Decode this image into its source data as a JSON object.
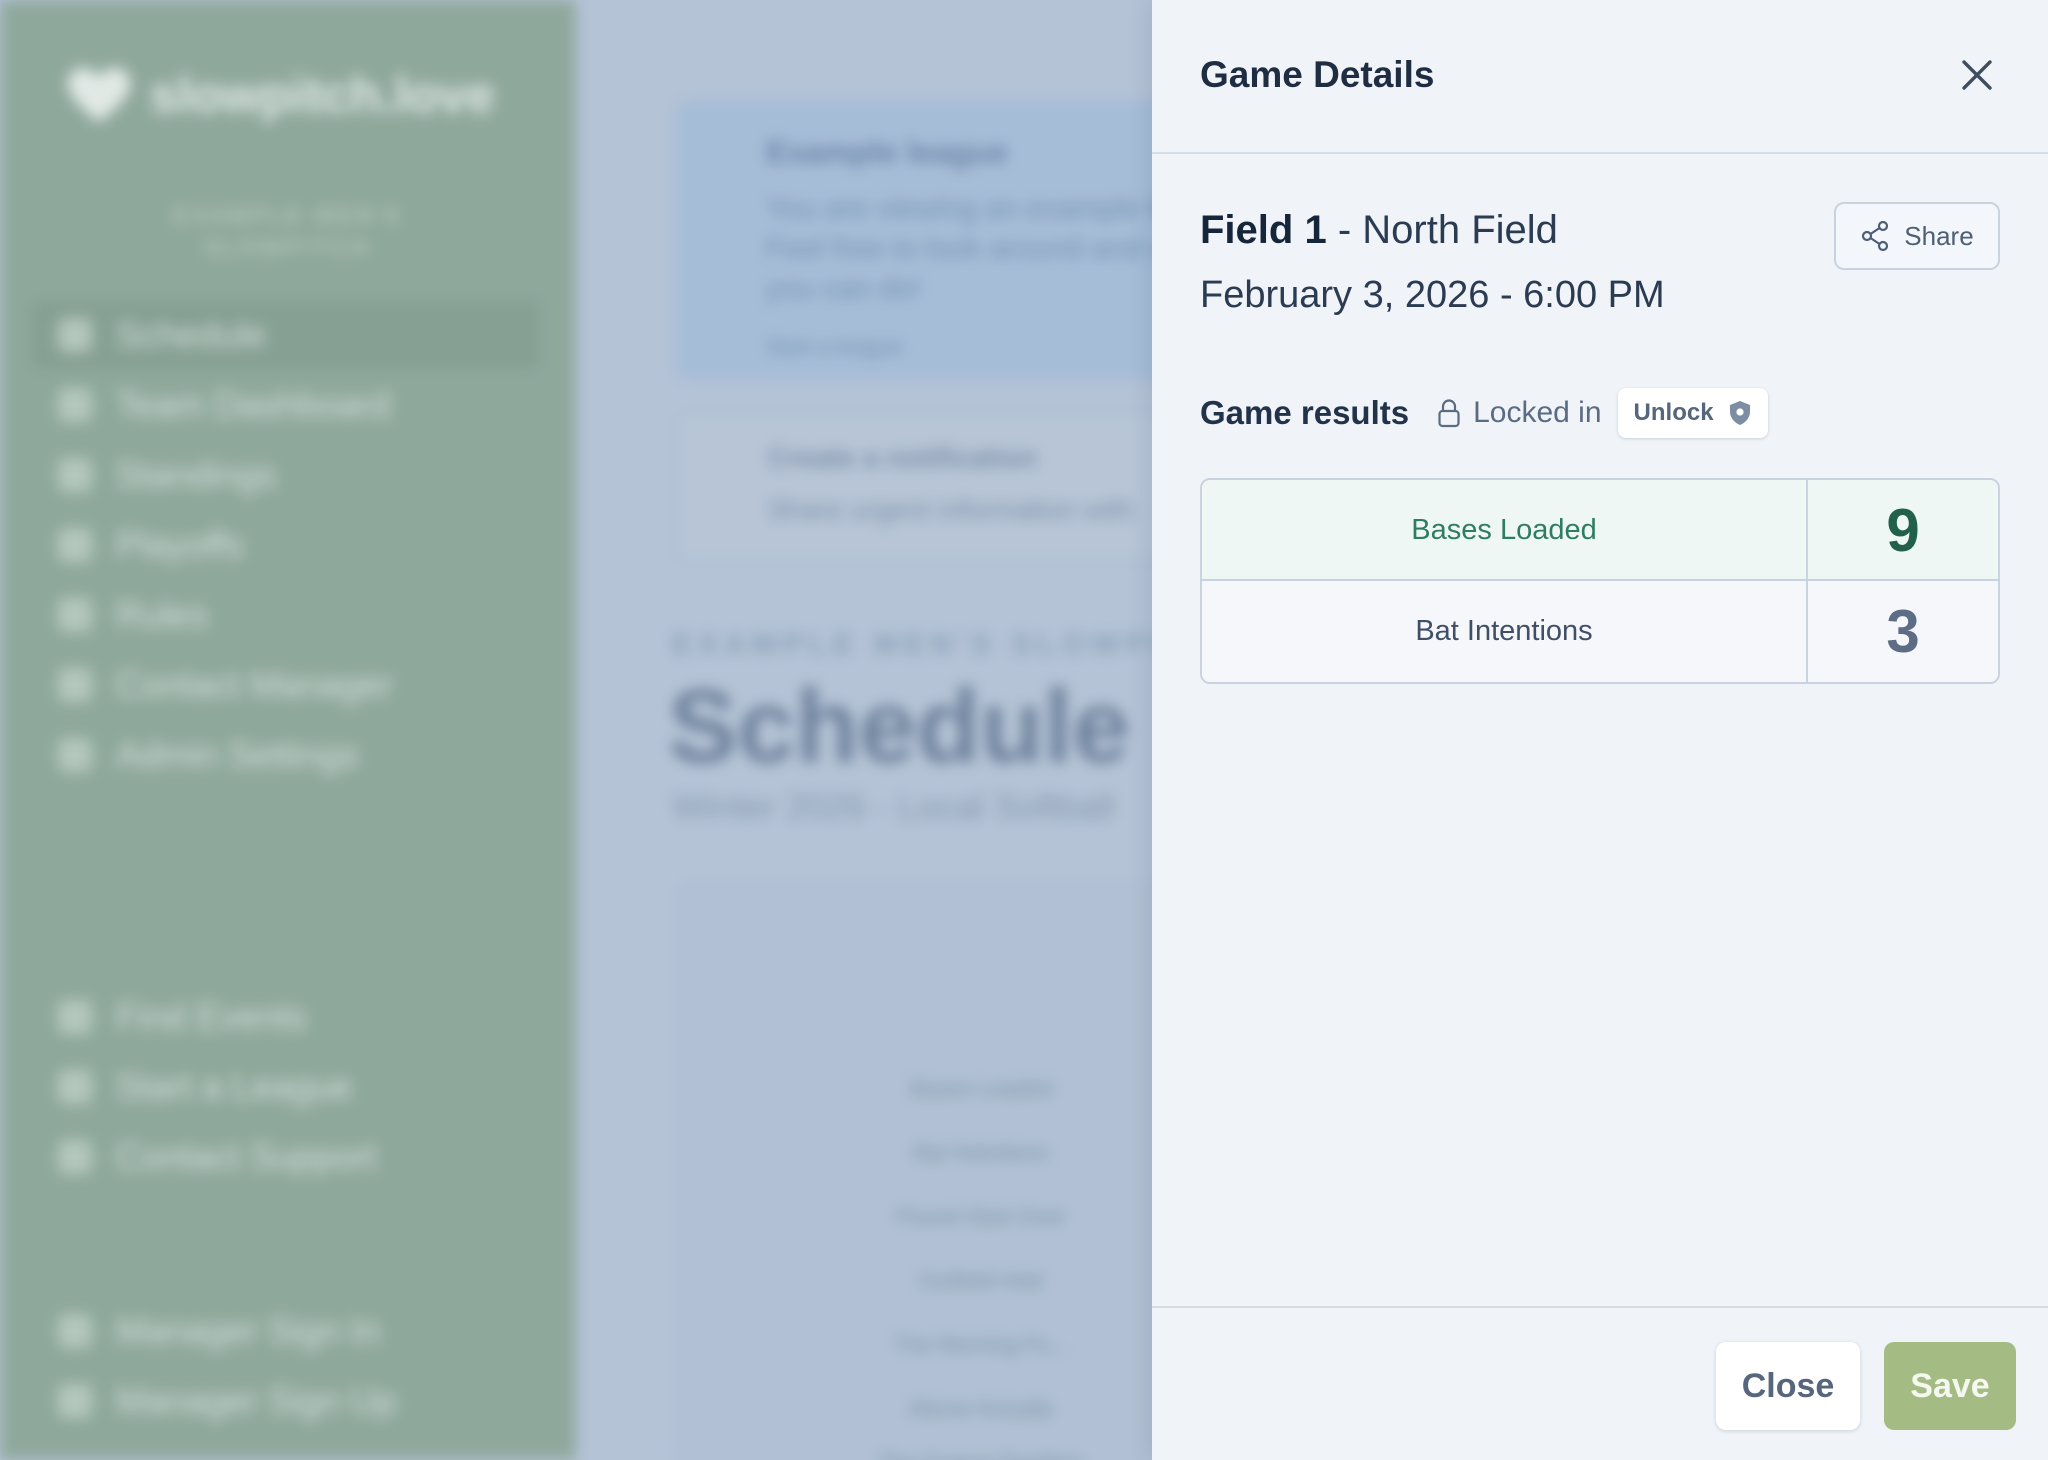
{
  "background": {
    "brand": "slowpitch.love",
    "org_lines": [
      "EXAMPLE MEN'S",
      "SLOWPITCH"
    ],
    "nav": {
      "main": [
        "Schedule",
        "Team Dashboard",
        "Standings",
        "Playoffs",
        "Rules",
        "Contact Manager",
        "Admin Settings"
      ],
      "secondary": [
        "Find Events",
        "Start a League",
        "Contact Support"
      ],
      "account": [
        "Manager Sign In",
        "Manager Sign Up"
      ]
    },
    "banner": {
      "title": "Example league",
      "text": "You are viewing an example league. Feel free to look around and see what you can do!",
      "link": "Start a league"
    },
    "notification": {
      "title": "Create a notification",
      "text": "Share urgent information with"
    },
    "kicker": "EXAMPLE MEN'S SLOWPITCH",
    "page_title": "Schedule",
    "subtitle": "Winter 2026 - Local Softball",
    "table_rows": [
      "Bases Loaded",
      "Bat Intentions",
      "Pound Start Over",
      "Outfield Intel",
      "The Morning Fo...",
      "Above Actually",
      "The Dugout Dwellers"
    ]
  },
  "drawer": {
    "title": "Game Details",
    "field_name": "Field 1",
    "field_location": "- North Field",
    "datetime": "February 3, 2026 - 6:00 PM",
    "share_label": "Share",
    "results_label": "Game results",
    "locked_label": "Locked in",
    "unlock_label": "Unlock",
    "results": [
      {
        "team": "Bases Loaded",
        "score": "9"
      },
      {
        "team": "Bat Intentions",
        "score": "3"
      }
    ],
    "close_label": "Close",
    "save_label": "Save"
  },
  "icons": {
    "close": "close-icon",
    "share": "share-icon",
    "lock": "lock-icon",
    "shield": "shield-icon"
  },
  "colors": {
    "sidebar": "#8fa99a",
    "drawer_bg": "#f0f4f8",
    "winner_text": "#2e7d62",
    "winner_row": "#eff7f4",
    "save_button": "#a4bb84"
  }
}
